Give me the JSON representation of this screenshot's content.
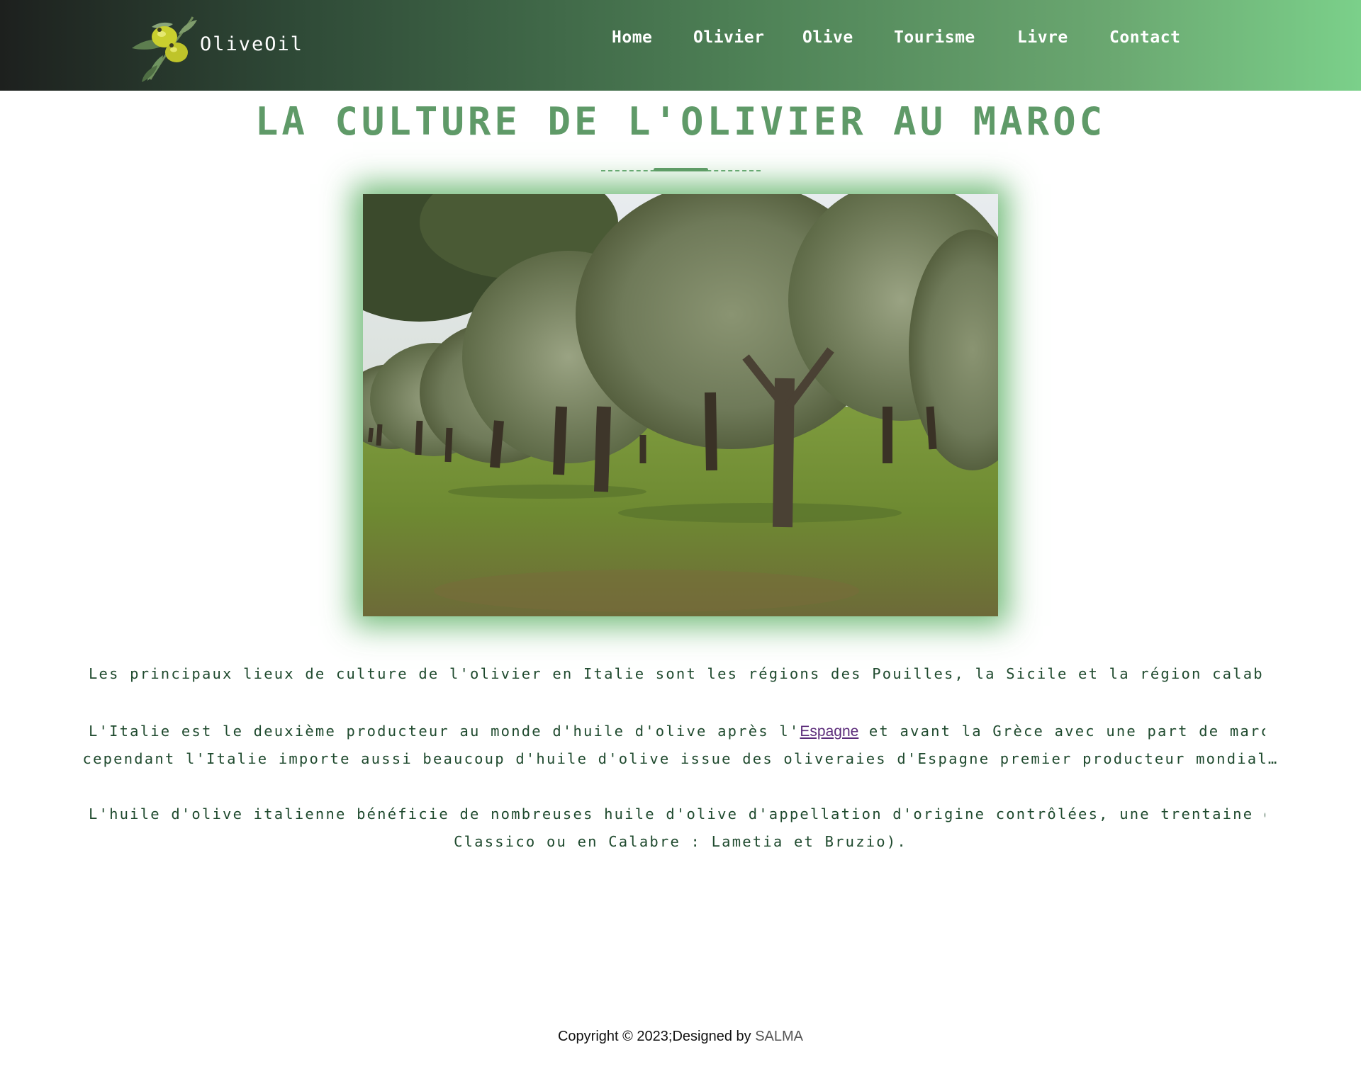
{
  "brand": {
    "name": "OliveOil"
  },
  "nav": [
    {
      "label": "Home"
    },
    {
      "label": "Olivier"
    },
    {
      "label": "Olive"
    },
    {
      "label": "Tourisme"
    },
    {
      "label": "Livre"
    },
    {
      "label": "Contact"
    }
  ],
  "main": {
    "title": "LA CULTURE DE L'OLIVIER AU MAROC",
    "paragraphs": {
      "p1": "Les principaux lieux de culture de l'olivier en Italie sont les régions des Pouilles, la Sicile et la région calabrais",
      "p2_before": "L'Italie est le deuxième producteur au monde d'huile d'olive après l'",
      "p2_link": "Espagne",
      "p2_after": " et avant la Grèce avec une part de marché d",
      "p2_line2": "cependant l'Italie importe aussi beaucoup d'huile d'olive issue des oliveraies d'Espagne premier producteur mondial…",
      "p3_line1": "L'huile d'olive italienne bénéficie de nombreuses huile d'olive d'appellation d'origine contrôlées, une trentaine envi",
      "p3_line2": "Classico ou en Calabre : Lametia et Bruzio)."
    }
  },
  "footer": {
    "text": "Copyright © 2023;Designed by ",
    "author": "SALMA"
  },
  "colors": {
    "accent": "#5f9a68",
    "header_start": "#1d201e",
    "header_end": "#7bd08a",
    "text": "#1f4a2e",
    "link": "#5b2b7a"
  },
  "icons": {
    "logo": "olive-branch-icon"
  }
}
